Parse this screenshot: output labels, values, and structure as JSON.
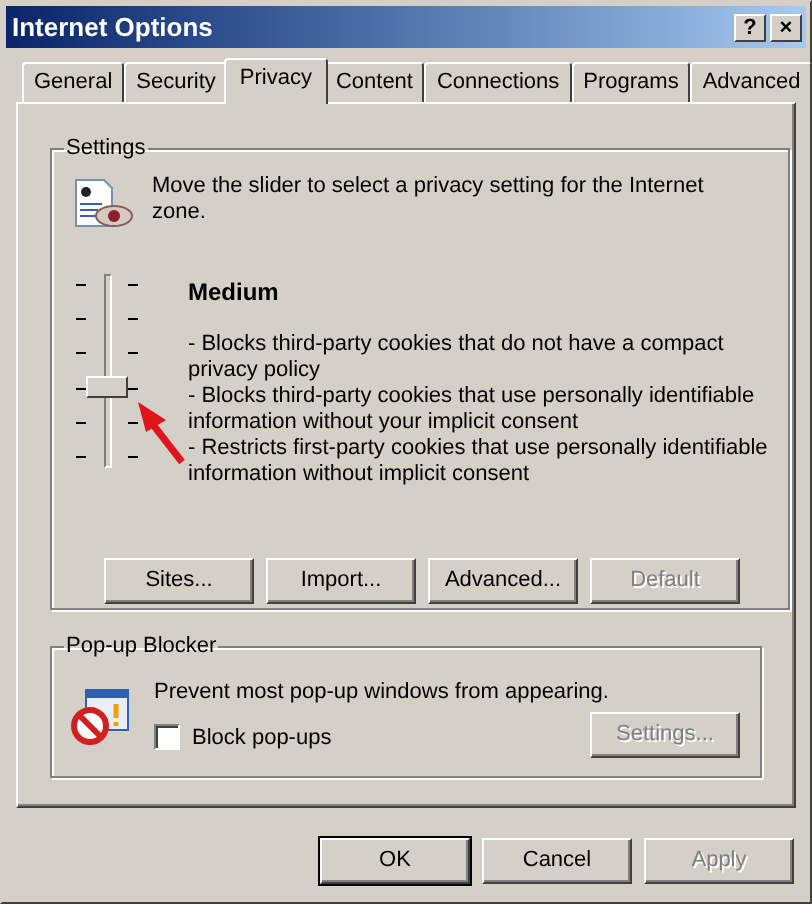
{
  "window": {
    "title": "Internet Options",
    "title_buttons": [
      "?",
      "×"
    ]
  },
  "tabs": [
    {
      "label": "General",
      "selected": false
    },
    {
      "label": "Security",
      "selected": false
    },
    {
      "label": "Privacy",
      "selected": true
    },
    {
      "label": "Content",
      "selected": false
    },
    {
      "label": "Connections",
      "selected": false
    },
    {
      "label": "Programs",
      "selected": false
    },
    {
      "label": "Advanced",
      "selected": false
    }
  ],
  "settings": {
    "label": "Settings",
    "intro": "Move the slider to select a privacy setting for the Internet zone.",
    "slider": {
      "level": 0.4
    },
    "level_name": "Medium",
    "description": [
      "- Blocks third-party cookies that do not have a compact privacy policy",
      "- Blocks third-party cookies that use personally identifiable information without your implicit consent",
      "- Restricts first-party cookies that use personally identifiable information without implicit consent"
    ],
    "buttons": [
      {
        "label": "Sites...",
        "disabled": false
      },
      {
        "label": "Import...",
        "disabled": false
      },
      {
        "label": "Advanced...",
        "disabled": false
      },
      {
        "label": "Default",
        "disabled": true
      }
    ]
  },
  "popup_blocker": {
    "label": "Pop-up Blocker",
    "description": "Prevent most pop-up windows from appearing.",
    "checkbox": {
      "label": "Block pop-ups",
      "checked": false
    },
    "settings_button": {
      "label": "Settings...",
      "disabled": true
    }
  },
  "buttons": [
    {
      "label": "OK",
      "default": true,
      "disabled": false
    },
    {
      "label": "Cancel",
      "default": false,
      "disabled": false
    },
    {
      "label": "Apply",
      "default": false,
      "disabled": true
    }
  ]
}
